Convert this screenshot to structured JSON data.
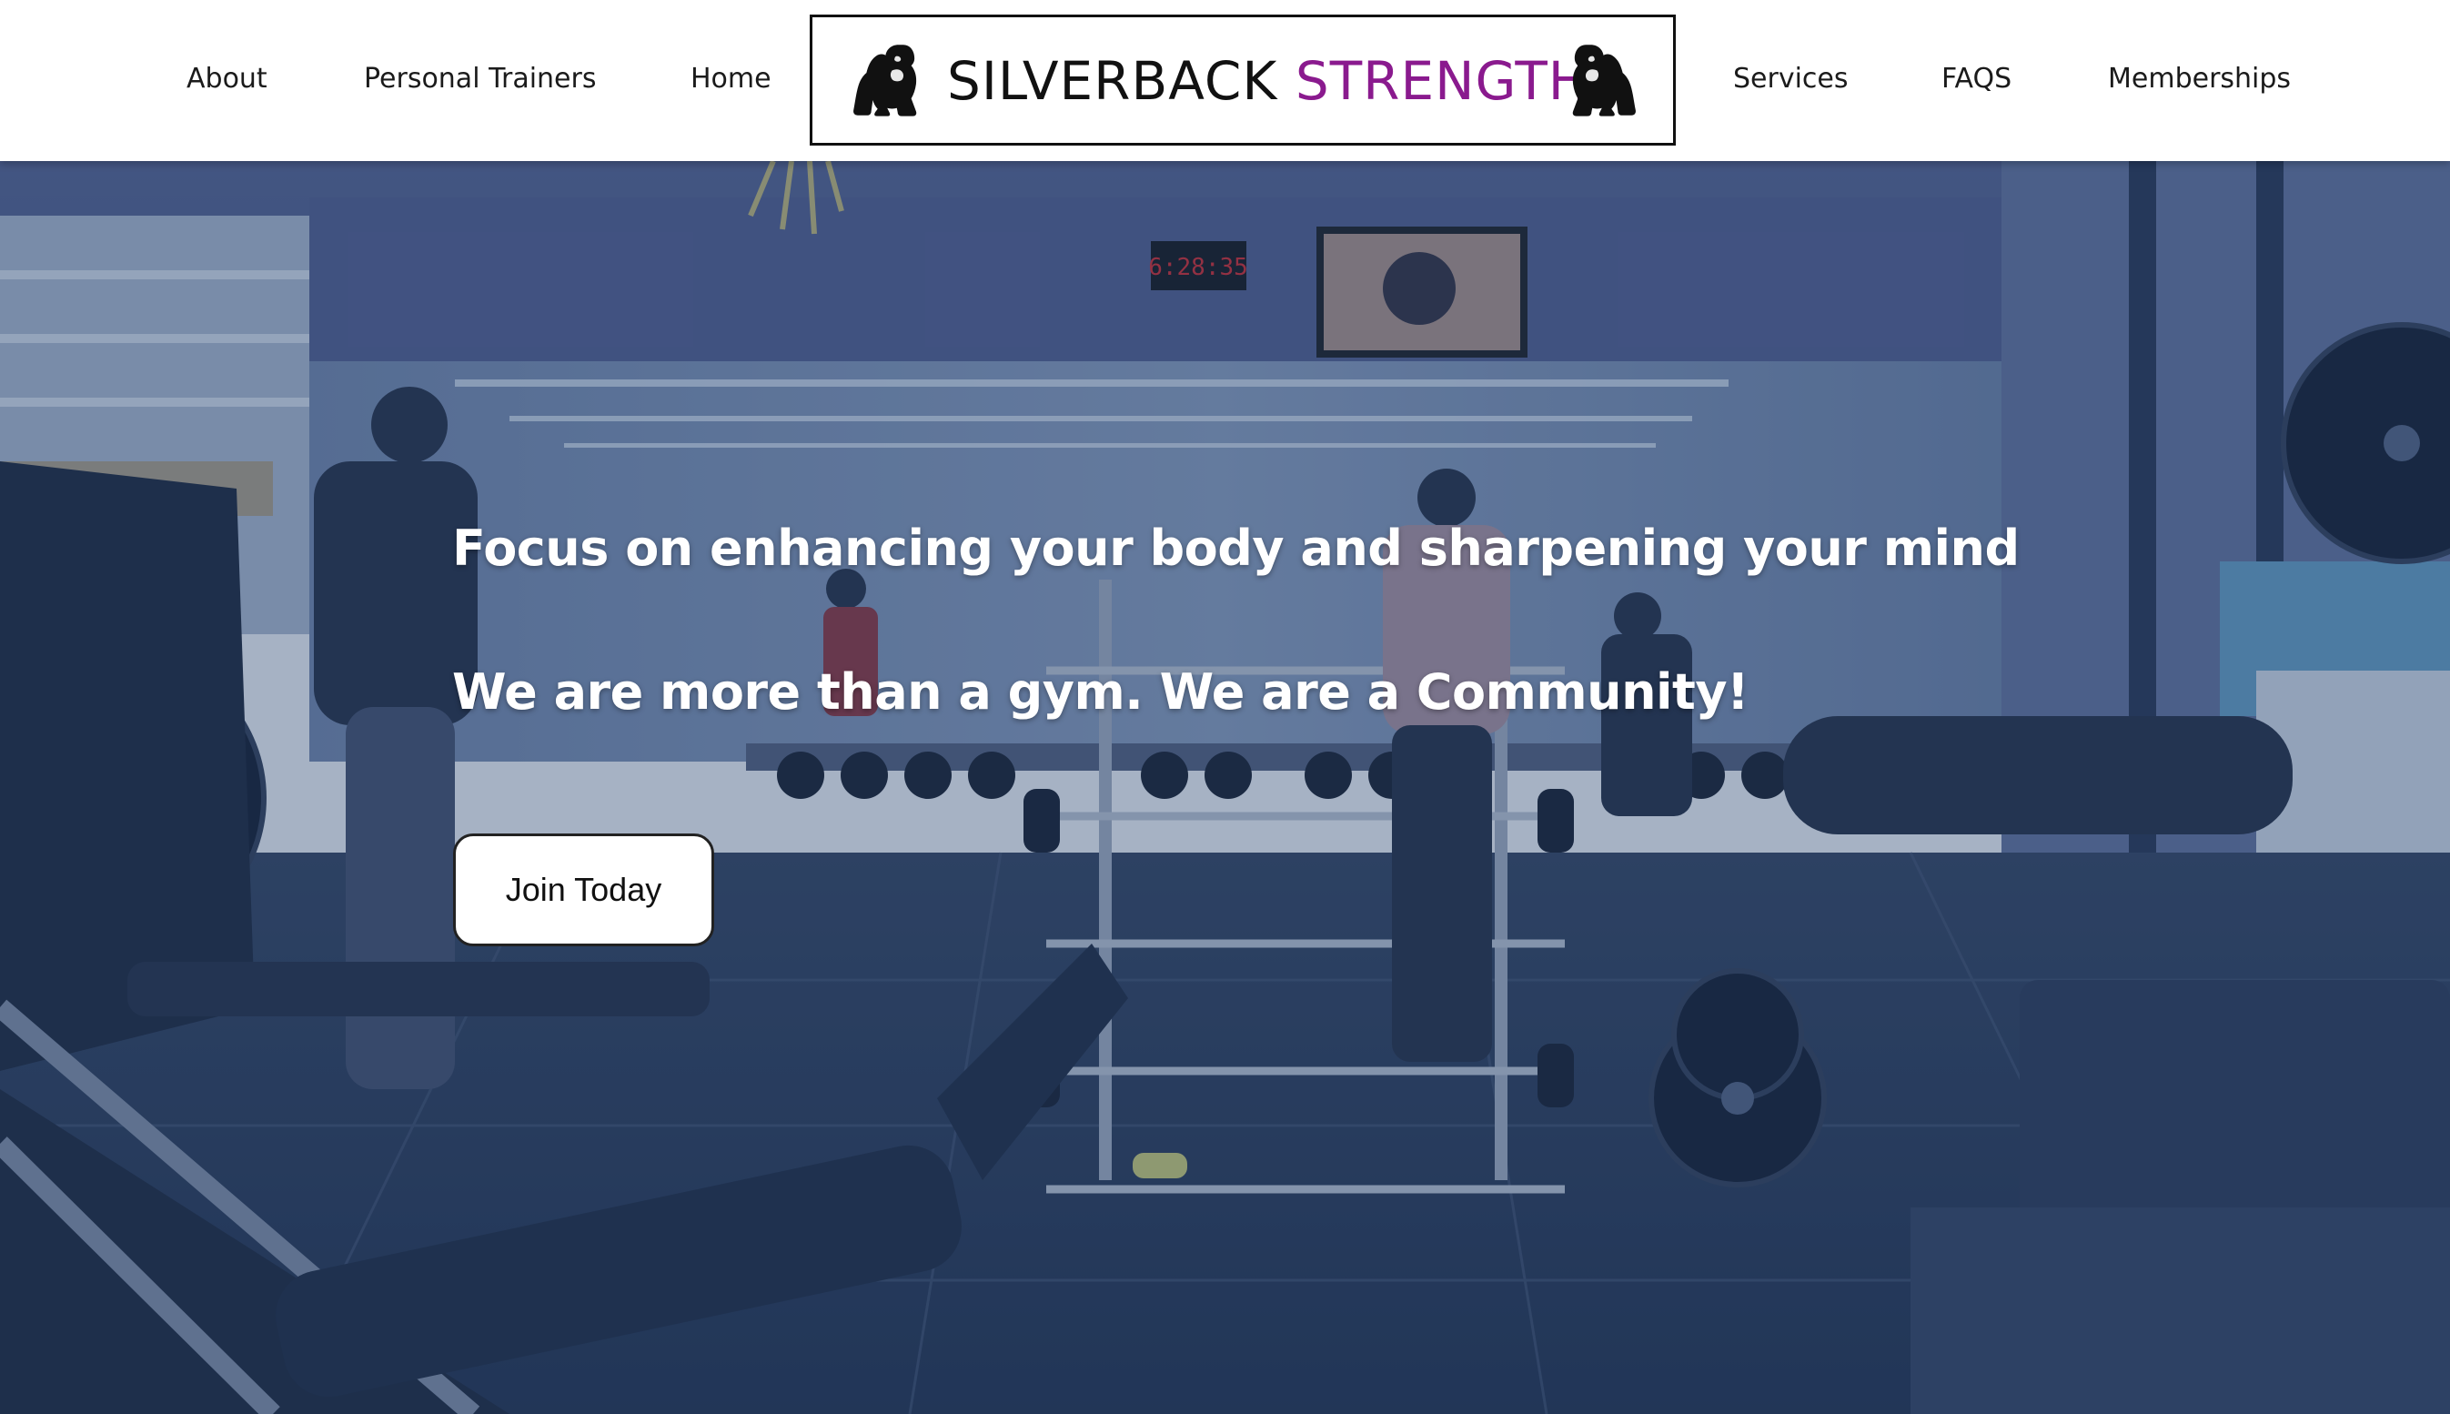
{
  "brand": {
    "name_primary": "SILVERBACK",
    "name_accent": "STRENGTH",
    "accent_color": "#8a1a8e",
    "logo_icon": "gorilla-icon"
  },
  "nav": {
    "left": [
      {
        "label": "About"
      },
      {
        "label": "Personal Trainers"
      },
      {
        "label": "Home"
      }
    ],
    "right": [
      {
        "label": "Services"
      },
      {
        "label": "FAQS"
      },
      {
        "label": "Memberships"
      }
    ]
  },
  "hero": {
    "headline_1": "Focus on enhancing your body and sharpening your mind",
    "headline_2": "We are more than a gym. We are a Community!",
    "cta_label": "Join Today",
    "overlay_color": "#163464"
  },
  "scene": {
    "timer_display": "6:28:35"
  }
}
